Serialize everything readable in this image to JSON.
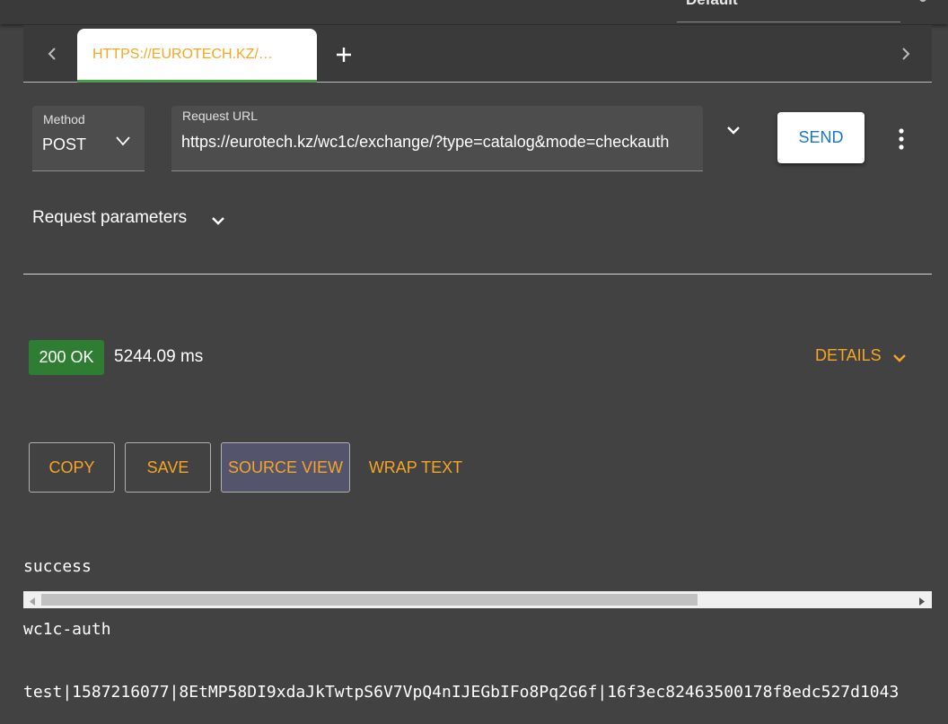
{
  "header": {
    "environment": "Default"
  },
  "tabs": {
    "items": [
      {
        "label": "HTTPS://EUROTECH.KZ/…"
      }
    ]
  },
  "request": {
    "method_label": "Method",
    "method_value": "POST",
    "url_label": "Request URL",
    "url_value": "https://eurotech.kz/wc1c/exchange/?type=catalog&mode=checkauth",
    "send_label": "SEND",
    "parameters_label": "Request parameters"
  },
  "response": {
    "status": "200 OK",
    "time": "5244.09 ms",
    "details_label": "DETAILS",
    "actions": {
      "copy": "COPY",
      "save": "SAVE",
      "source_view": "SOURCE VIEW",
      "wrap_text": "WRAP TEXT"
    },
    "body_lines": [
      "success",
      "wc1c-auth",
      "test|1587216077|8EtMP58DI9xdaJkTwtpS6V7VpQ4nIJEGbIFo8Pq2G6f|16f3ec82463500178f8edc527d1043"
    ],
    "scroll_position": 0.0
  },
  "colors": {
    "accent": "#f6a623",
    "success": "#2e7d32",
    "send": "#1976d2",
    "background": "#424242",
    "tab_indicator": "#43a047"
  },
  "icons": {
    "tab_prev": "chevron-left-icon",
    "tab_next": "chevron-right-icon",
    "tab_add": "plus-icon",
    "method_dropdown": "chevron-down-icon",
    "url_dropdown": "chevron-down-icon",
    "more": "more-vert-icon",
    "params_toggle": "chevron-down-icon",
    "details_toggle": "chevron-down-icon"
  }
}
